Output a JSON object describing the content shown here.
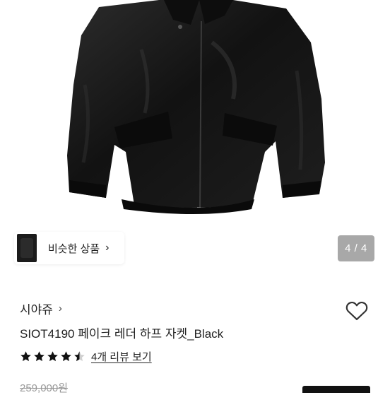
{
  "gallery": {
    "page_indicator": "4 / 4",
    "similar_products_label": "비슷한 상품",
    "similar_chevron": "›"
  },
  "product": {
    "brand": "시야쥬",
    "brand_chevron": "›",
    "title": "SIOT4190 페이크 레더 하프 자켓_Black",
    "rating_stars": 4.5,
    "review_link": "4개 리뷰 보기",
    "original_price": "259,000원"
  },
  "icons": {
    "heart": "heart-outline-icon",
    "star": "star-icon"
  },
  "colors": {
    "jacket": "#141414",
    "indicator_bg": "#a8a8a8",
    "text": "#222222"
  }
}
